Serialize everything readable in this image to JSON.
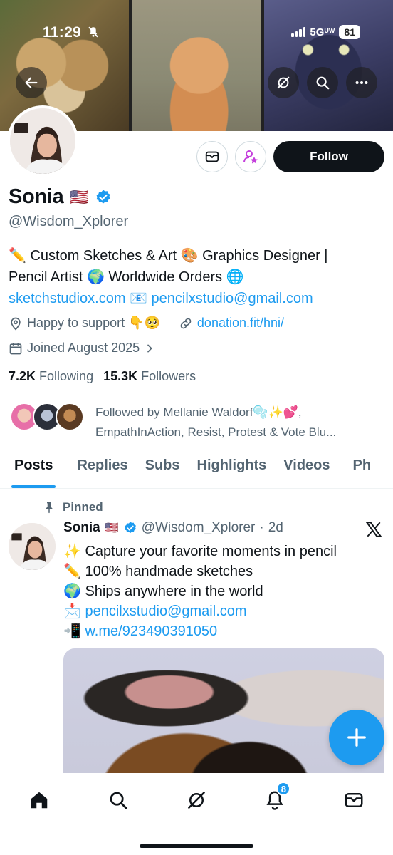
{
  "status_bar": {
    "time": "11:29",
    "network": "5G",
    "network_suffix": "UW",
    "battery": "81"
  },
  "profile": {
    "name": "Sonia",
    "handle": "@Wisdom_Xplorer",
    "flag": "🇺🇸",
    "bio_line1": "✏️ Custom Sketches & Art 🎨 Graphics Designer |",
    "bio_line2": "Pencil Artist 🌍 Worldwide Orders 🌐",
    "bio_link_site": "sketchstudiox.com",
    "bio_mail_emoji": "📧",
    "bio_link_email": "pencilxstudio@gmail.com",
    "location": "Happy to support 👇🥺",
    "website": "donation.fit/hni/",
    "joined": "Joined August 2025",
    "following_count": "7.2K",
    "following_label": "Following",
    "followers_count": "15.3K",
    "followers_label": "Followers",
    "followed_by_line1": "Followed by Mellanie Waldorf🫧✨💕,",
    "followed_by_line2": "EmpathInAction, Resist, Protest & Vote Blu..."
  },
  "buttons": {
    "follow": "Follow"
  },
  "tabs": [
    {
      "label": "Posts"
    },
    {
      "label": "Replies"
    },
    {
      "label": "Subs"
    },
    {
      "label": "Highlights"
    },
    {
      "label": "Videos"
    },
    {
      "label": "Ph"
    }
  ],
  "tweet": {
    "pinned_label": "Pinned",
    "author": "Sonia",
    "flag": "🇺🇸",
    "handle": "@Wisdom_Xplorer",
    "time": "2d",
    "line1": "✨ Capture your favorite moments in pencil",
    "line2": "✏️ 100% handmade sketches",
    "line3": "🌍 Ships anywhere in the world",
    "line4_emoji": "📩",
    "line4_link": "pencilxstudio@gmail.com",
    "line5_emoji": "📲",
    "line5_link": "w.me/923490391050"
  },
  "notifications_badge": "8",
  "icons": [
    "back-arrow-icon",
    "grok-icon",
    "search-icon",
    "more-icon",
    "message-icon",
    "subscribe-icon",
    "location-icon",
    "link-icon",
    "calendar-icon",
    "pin-icon",
    "verified-icon",
    "x-logo-icon",
    "plus-icon",
    "home-icon",
    "bell-icon",
    "mail-icon"
  ],
  "colors": {
    "accent": "#1d9bf0",
    "text": "#0f1419",
    "secondary": "#536471",
    "subscribe": "#c43fdc"
  }
}
